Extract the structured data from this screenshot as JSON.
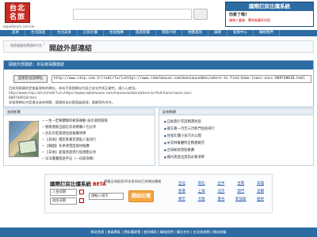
{
  "header": {
    "logo_text": "台北\n名旅",
    "logo_url": "taipeiforum.com.tw",
    "brand_title": "國際訂房比價系統",
    "brand_question": "你累了嗎?",
    "brand_sub": "讓旅人靈感、專家推薦好住宿"
  },
  "nav": [
    "首頁",
    "台北旅遊",
    "台北美食",
    "訂房比價",
    "住宿推薦",
    "旅遊新聞",
    "景點介紹",
    "地圖查詢",
    "論壇",
    "會員中心",
    "聯絡我們"
  ],
  "breadcrumb": {
    "small": "首頁會員免費發佈平台",
    "big": "開啟外部連結"
  },
  "external": {
    "heading": "開啟外部連結：本站會員翻連結",
    "copy_button": "直接前往該網址",
    "url": "http://www.chip.com.tr/redir?url=https://www.rebelmouse.com/manianseddon/where-to-find-home-loans-novi-889740018.html",
    "note1": "目前您點開的是會員發佈的網址，本站不保證網址內容之安全性與正確性，請小心使用。",
    "note2": "http://www.chip.com.tr/redir?url=https://www.rebelmouse.com/manianseddon/where-to-find-home-loans-novi-",
    "note3": "889740018.html",
    "note4": "如發現網址內容違法或有問題，請通知本站管理員處理，謝謝您的合作。"
  },
  "left_panel": {
    "heading": "旅遊新聞",
    "news": [
      "一生一定要體驗的極限運動-溪水滑翔冒險",
      "春節連假出國訂房攻略懶人包分享",
      "台北市區質感住宿推薦清單",
      "【日本】櫻花季賞花景點人氣排行",
      "【韓國】冬季滑雪度假村推薦",
      "【日本】超值周遊券行程規劃分享",
      "洋洋灑灑旅遊手記（一日遊攻略）"
    ]
  },
  "right_panel": {
    "heading": "延伸閱讀",
    "items": [
      "自助旅行年度精選住宿",
      "搶先看一月至三月熱門住宿排行",
      "住宿比價小技巧大公開",
      "米其林餐廳附近精選飯店",
      "台灣秘境景點推薦",
      "國內旅遊出發前必看清單"
    ]
  },
  "compare": {
    "title": "國際訂房比價系統",
    "badge": "BETA",
    "desc": "網羅全球超過30多家知名訂房網站價格",
    "checkin": "入住日期",
    "checkout": "退房日期",
    "city_placeholder": "請輸入城市",
    "button": "開始比價",
    "cities": [
      "台北",
      "新北",
      "台中",
      "台南",
      "高雄",
      "香港",
      "上海",
      "北京",
      "澳門",
      "首爾",
      "東京",
      "大阪",
      "曼谷",
      "新加坡",
      "紐約"
    ]
  },
  "footer": "網站首頁 | 會員專區 | 隱私權政策 | 使用條款 | 聯絡我們 | 廣告合作 | 台北旅遊網 | 網站地圖"
}
